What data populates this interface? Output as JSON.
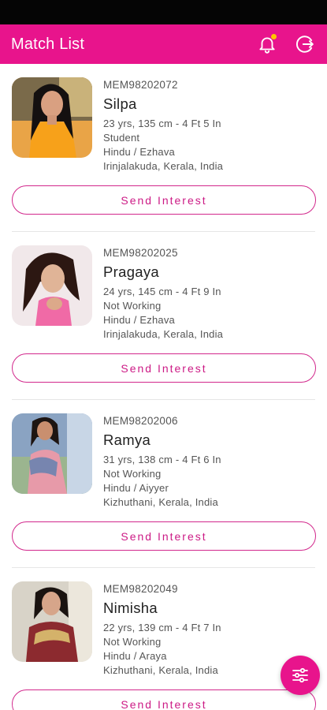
{
  "app_bar": {
    "title": "Match List",
    "notification_icon": "bell-icon",
    "logout_icon": "logout-icon",
    "accent_color": "#e8148c",
    "badge_color": "#ffc400"
  },
  "matches": [
    {
      "member_id": "MEM98202072",
      "name": "Silpa",
      "age_height": "23 yrs, 135 cm - 4 Ft 5 In",
      "occupation": "Student",
      "religion_caste": "Hindu / Ezhava",
      "location": "Irinjalakuda, Kerala, India",
      "action_label": "Send Interest"
    },
    {
      "member_id": "MEM98202025",
      "name": "Pragaya",
      "age_height": "24 yrs, 145 cm - 4 Ft 9 In",
      "occupation": "Not Working",
      "religion_caste": "Hindu / Ezhava",
      "location": "Irinjalakuda, Kerala, India",
      "action_label": "Send Interest"
    },
    {
      "member_id": "MEM98202006",
      "name": "Ramya",
      "age_height": "31 yrs, 138 cm - 4 Ft 6 In",
      "occupation": "Not Working",
      "religion_caste": "Hindu / Aiyyer",
      "location": "Kizhuthani, Kerala, India",
      "action_label": "Send Interest"
    },
    {
      "member_id": "MEM98202049",
      "name": "Nimisha",
      "age_height": "22 yrs, 139 cm - 4 Ft 7 In",
      "occupation": "Not Working",
      "religion_caste": "Hindu / Araya",
      "location": "Kizhuthani, Kerala, India",
      "action_label": "Send Interest"
    }
  ],
  "fab": {
    "icon": "filter-sliders-icon"
  }
}
